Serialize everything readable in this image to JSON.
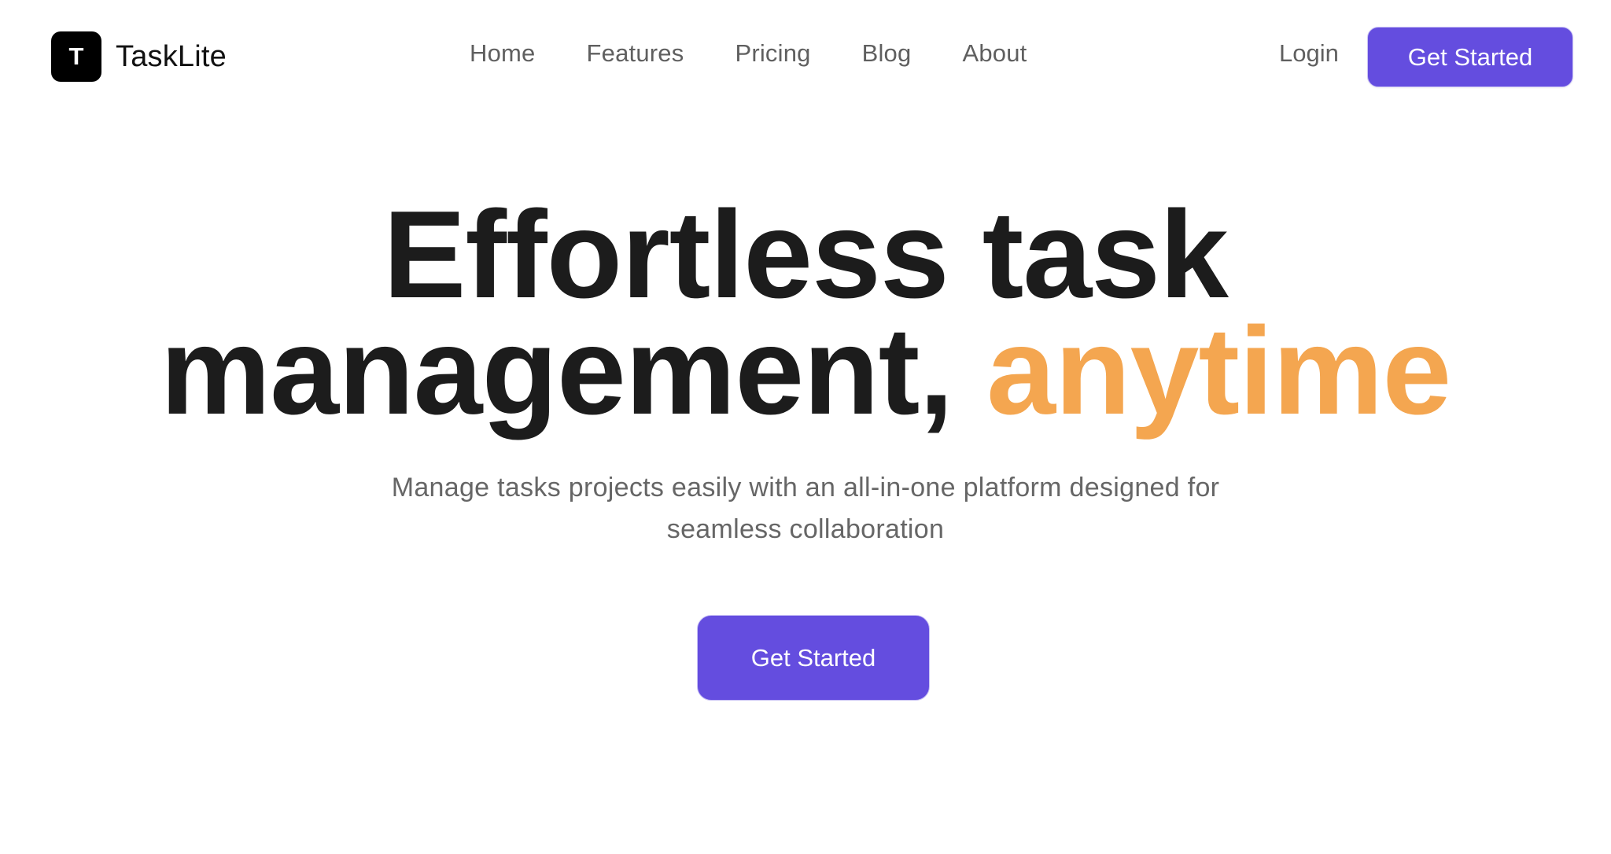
{
  "brand": {
    "logo_letter": "T",
    "name": "TaskLite"
  },
  "nav": {
    "items": [
      {
        "label": "Home"
      },
      {
        "label": "Features"
      },
      {
        "label": "Pricing"
      },
      {
        "label": "Blog"
      },
      {
        "label": "About"
      }
    ]
  },
  "header_actions": {
    "login_label": "Login",
    "cta_label": "Get Started"
  },
  "hero": {
    "headline_line1": "Effortless task",
    "headline_line2": "management,",
    "headline_accent": "anytime",
    "subtitle": "Manage tasks projects easily with an all-in-one platform designed for seamless collaboration",
    "cta_label": "Get Started"
  },
  "colors": {
    "accent_purple": "#644ddf",
    "accent_orange": "#f4a650",
    "text_dark": "#1c1c1c",
    "text_muted": "#5f5f5f"
  }
}
